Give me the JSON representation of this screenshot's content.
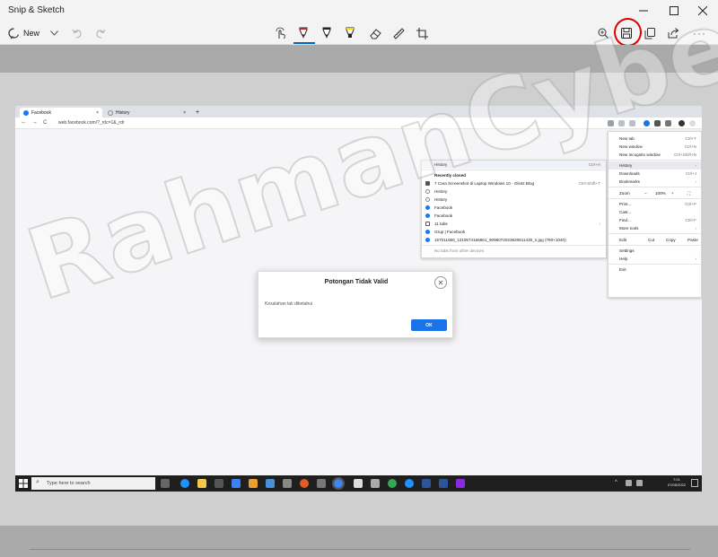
{
  "app": {
    "title": "Snip & Sketch"
  },
  "window_controls": {
    "minimize": "—",
    "maximize": "☐",
    "close": "✕"
  },
  "toolbar": {
    "new_label": "New",
    "more_glyph": "···",
    "accent_color": "#0067c0",
    "highlight_circle_color": "#e00000",
    "icons": [
      "new-snip-icon",
      "chevron-down-icon",
      "undo-icon",
      "redo-icon",
      "touch-writing-icon",
      "ballpoint-pen-icon",
      "pencil-icon",
      "highlighter-icon",
      "eraser-icon",
      "ruler-icon",
      "crop-icon",
      "zoom-icon",
      "save-icon",
      "copy-icon",
      "share-icon",
      "more-icon"
    ]
  },
  "browser": {
    "tabs": [
      {
        "label": "Facebook",
        "close": "×"
      },
      {
        "label": "History",
        "close": "×"
      }
    ],
    "new_tab": "+",
    "url": "web.facebook.com/?_rdc=1&_rdr",
    "nav": {
      "back": "←",
      "forward": "→",
      "reload": "C"
    },
    "history_menu": {
      "header": "History",
      "header_shortcut": "Ctrl+H",
      "section": "Recently closed",
      "items": [
        {
          "label": "7 Cara Screenshot di Laptop Windows 10 - Glintz Blog",
          "shortcut": "Ctrl+Shift+T"
        },
        {
          "label": "History",
          "shortcut": ""
        },
        {
          "label": "History",
          "shortcut": ""
        },
        {
          "label": "Facebook",
          "shortcut": ""
        },
        {
          "label": "Facebook",
          "shortcut": ""
        },
        {
          "label": "11 tabs",
          "shortcut": ""
        },
        {
          "label": "Grup | Facebook",
          "shortcut": ""
        },
        {
          "label": "157011060_1210574166661_9098072023820811430_n.jpg (780×1040)",
          "shortcut": ""
        }
      ],
      "footer": "No tabs from other devices"
    },
    "main_menu": {
      "items": [
        {
          "label": "New tab",
          "shortcut": "Ctrl+T"
        },
        {
          "label": "New window",
          "shortcut": "Ctrl+N"
        },
        {
          "label": "New Incognito window",
          "shortcut": "Ctrl+Shift+N"
        },
        {
          "label": "History",
          "shortcut": "›"
        },
        {
          "label": "Downloads",
          "shortcut": "Ctrl+J"
        },
        {
          "label": "Bookmarks",
          "shortcut": "›"
        }
      ],
      "zoom": {
        "label": "Zoom",
        "minus": "−",
        "value": "100%",
        "plus": "+",
        "full": "⛶"
      },
      "items2": [
        {
          "label": "Print...",
          "shortcut": "Ctrl+P"
        },
        {
          "label": "Cast...",
          "shortcut": ""
        },
        {
          "label": "Find...",
          "shortcut": "Ctrl+F"
        },
        {
          "label": "More tools",
          "shortcut": "›"
        }
      ],
      "edit": {
        "label": "Edit",
        "cut": "Cut",
        "copy": "Copy",
        "paste": "Paste"
      },
      "items3": [
        {
          "label": "Settings",
          "shortcut": ""
        },
        {
          "label": "Help",
          "shortcut": "›"
        }
      ],
      "exit": "Exit"
    }
  },
  "dialog": {
    "title": "Potongan Tidak Valid",
    "message": "Kesalahan tak diketahui",
    "ok": "OK",
    "close": "✕"
  },
  "taskbar": {
    "search_placeholder": "Type here to search",
    "time": "7:01",
    "date": "07/05/2022"
  },
  "watermark": {
    "text": "RahmanCyber.NET"
  }
}
